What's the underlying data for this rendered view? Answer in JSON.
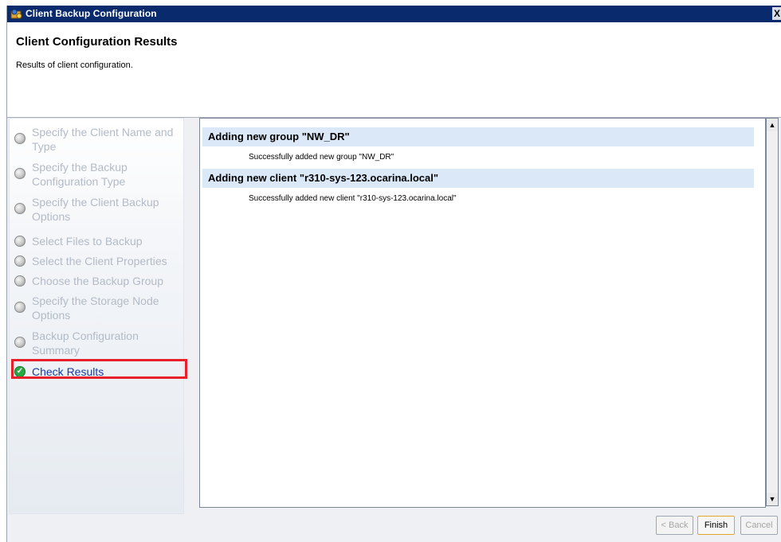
{
  "window": {
    "title": "Client Backup Configuration",
    "close_glyph": "X"
  },
  "header": {
    "title": "Client Configuration Results",
    "subtitle": "Results of client configuration."
  },
  "steps": [
    {
      "label": "Specify the Client Name and Type",
      "status": "pending"
    },
    {
      "label": "Specify the Backup Configuration Type",
      "status": "pending"
    },
    {
      "label": "Specify the Client Backup Options",
      "status": "pending"
    },
    {
      "label": "Select Files to Backup",
      "status": "pending"
    },
    {
      "label": "Select the Client Properties",
      "status": "pending"
    },
    {
      "label": "Choose the Backup Group",
      "status": "pending"
    },
    {
      "label": "Specify the Storage Node Options",
      "status": "pending"
    },
    {
      "label": "Backup Configuration Summary",
      "status": "pending"
    },
    {
      "label": "Check Results",
      "status": "complete"
    }
  ],
  "results": [
    {
      "heading": "Adding new group \"NW_DR\"",
      "message": "Successfully added new group \"NW_DR\""
    },
    {
      "heading": "Adding new client \"r310-sys-123.ocarina.local\"",
      "message": "Successfully added new client \"r310-sys-123.ocarina.local\""
    }
  ],
  "buttons": {
    "back": "< Back",
    "finish": "Finish",
    "cancel": "Cancel"
  },
  "colors": {
    "highlight": "#e8202a",
    "titlebar": "#0a2a6e",
    "result_header": "#dbe8f7"
  }
}
